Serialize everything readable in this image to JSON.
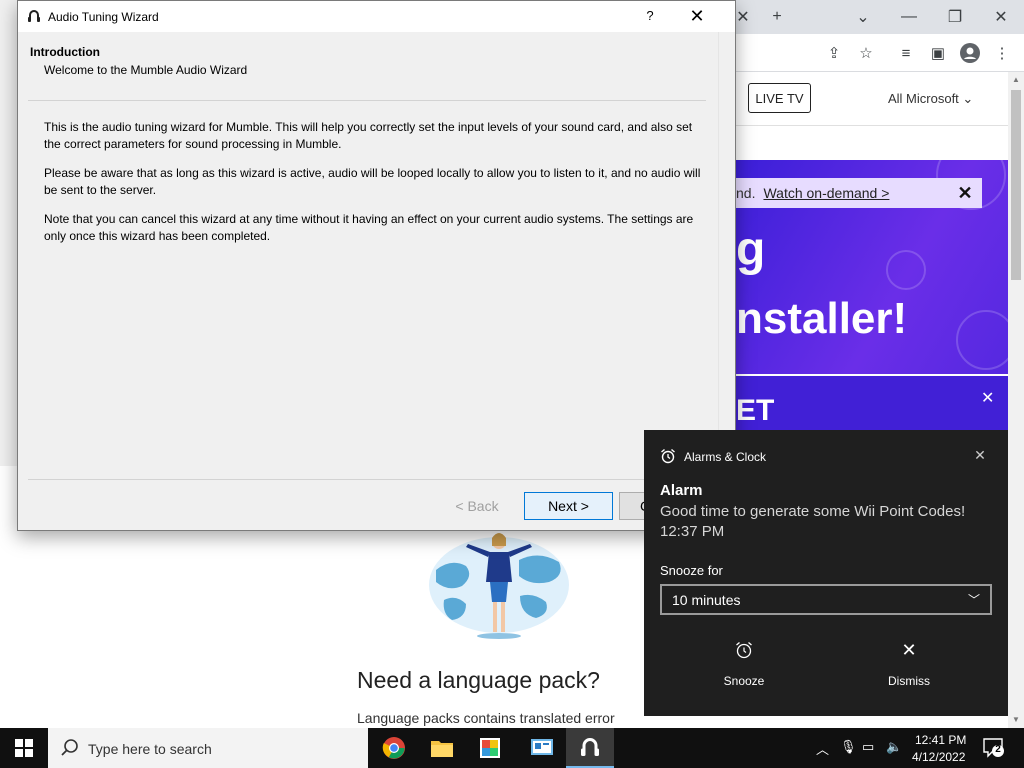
{
  "browser": {
    "new_tab_icon": "+",
    "site": {
      "live_tv": "LIVE TV",
      "all_microsoft": "All Microsoft",
      "banner_cut": "nd.",
      "banner_link": "Watch on-demand >",
      "hero_line1": "g",
      "hero_line2": "nstaller!",
      "hero2_text": "ET"
    },
    "page": {
      "heading": "Need a language pack?",
      "subtext": "Language packs contains translated error"
    }
  },
  "wizard": {
    "title": "Audio Tuning Wizard",
    "help": "?",
    "heading": "Introduction",
    "subheading": "Welcome to the Mumble Audio Wizard",
    "paragraphs": [
      "This is the audio tuning wizard for Mumble. This will help you correctly set the input levels of your sound card, and also set the correct parameters for sound processing in Mumble.",
      "Please be aware that as long as this wizard is active, audio will be looped locally to allow you to listen to it, and no audio will be sent to the server.",
      "Note that you can cancel this wizard at any time without it having an effect on your current audio systems. The settings are only once this wizard has been completed."
    ],
    "back": "< Back",
    "next": "Next >",
    "cancel": "C"
  },
  "toast": {
    "app": "Alarms & Clock",
    "title": "Alarm",
    "message": "Good time to generate some Wii Point Codes!",
    "time": "12:37 PM",
    "snooze_label": "Snooze for",
    "snooze_value": "10 minutes",
    "snooze_button": "Snooze",
    "dismiss_button": "Dismiss"
  },
  "taskbar": {
    "search_placeholder": "Type here to search",
    "time": "12:41 PM",
    "date": "4/12/2022",
    "notification_count": "2"
  },
  "colors": {
    "hero": "#5528e0",
    "toast_bg": "#1f1f1f",
    "taskbar_bg": "#101010",
    "accent": "#0078d7"
  }
}
